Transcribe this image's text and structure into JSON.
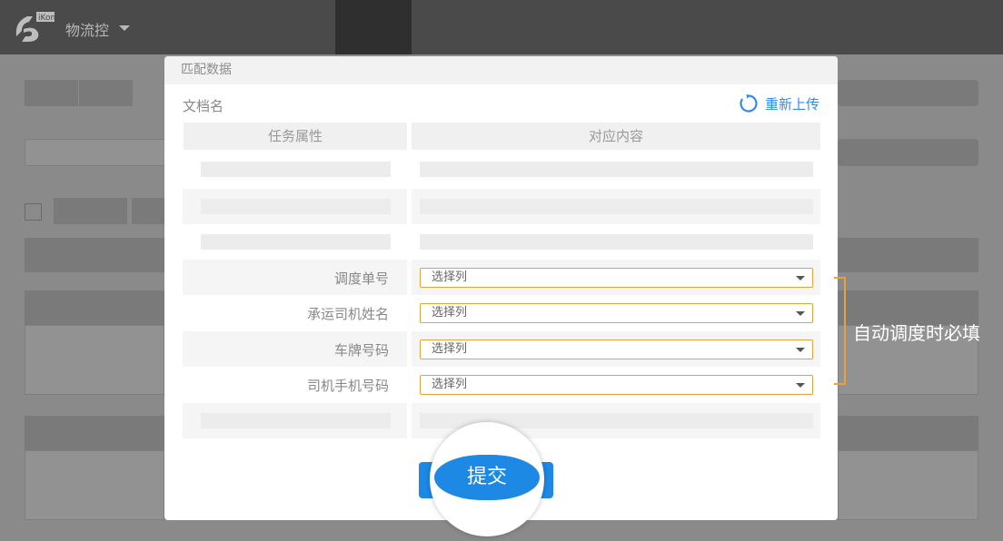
{
  "app": {
    "title": "物流控",
    "logo_text": "iKon"
  },
  "modal": {
    "title": "匹配数据",
    "doc_label": "文档名",
    "reupload_label": "重新上传",
    "columns": {
      "attribute": "任务属性",
      "content": "对应内容"
    },
    "fields": [
      {
        "label": "调度单号",
        "placeholder": "选择列"
      },
      {
        "label": "承运司机姓名",
        "placeholder": "选择列"
      },
      {
        "label": "车牌号码",
        "placeholder": "选择列"
      },
      {
        "label": "司机手机号码",
        "placeholder": "选择列"
      }
    ],
    "submit_label": "提交"
  },
  "annotation": {
    "bracket_text": "自动调度时必填",
    "bracket_color": "#e6a23c"
  },
  "colors": {
    "accent": "#1e88e5",
    "link": "#2d8cf0",
    "select_border": "#e6a23c"
  },
  "icons": {
    "reupload": "refresh-icon",
    "dropdown": "chevron-down-icon"
  }
}
